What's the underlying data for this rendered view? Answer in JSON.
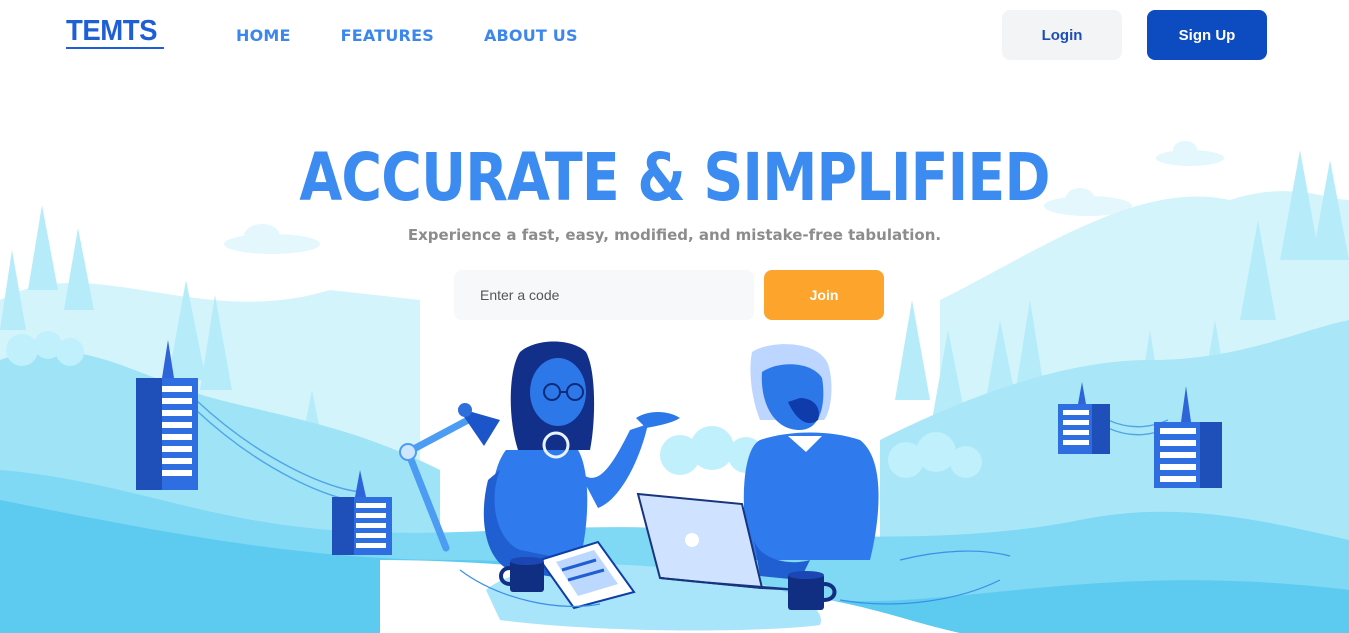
{
  "brand": {
    "logo_text": "TEMTS"
  },
  "nav": {
    "links": [
      {
        "label": "HOME"
      },
      {
        "label": "FEATURES"
      },
      {
        "label": "ABOUT US"
      }
    ]
  },
  "auth": {
    "login_label": "Login",
    "signup_label": "Sign Up"
  },
  "hero": {
    "title": "ACCURATE & SIMPLIFIED",
    "subtitle": "Experience a fast, easy, modified, and mistake-free tabulation.",
    "code_placeholder": "Enter a code",
    "code_value": "",
    "join_label": "Join"
  },
  "colors": {
    "brand_blue": "#1f5fd6",
    "nav_blue": "#3b87ee",
    "signup_blue": "#0c4cc0",
    "join_orange": "#fca42c",
    "subtitle_gray": "#8c8c8c",
    "scenery_light": "#c4f0fb",
    "scenery_mid": "#8adcf5",
    "figure_blue": "#1e6fe0"
  },
  "illustration": {
    "icons": [
      "building-icon",
      "desk-lamp-icon",
      "laptop-icon",
      "coffee-mug-icon",
      "tablet-icon",
      "tree-icon",
      "cloud-icon"
    ]
  }
}
